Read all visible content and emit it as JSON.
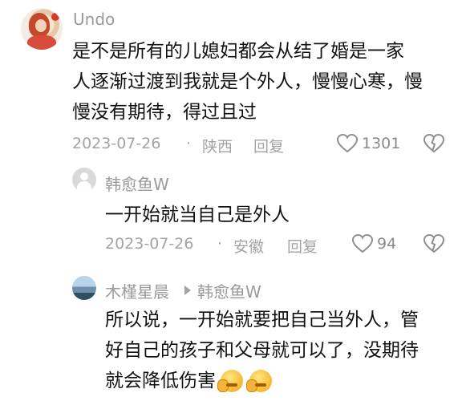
{
  "comments": [
    {
      "username": "Undo",
      "text_lines": [
        "是不是所有的儿媳妇都会从结了婚是一家",
        "人逐渐过渡到我就是个外人，慢慢心寒，慢",
        "慢没有期待，得过且过"
      ],
      "date": "2023-07-26",
      "separator": "·",
      "location": "陕西",
      "reply_label": "回复",
      "likes": "1301"
    }
  ],
  "replies": [
    {
      "username": "韩愈鱼W",
      "text_lines": [
        "一开始就当自己是外人"
      ],
      "date": "2023-07-26",
      "separator": "·",
      "location": "安徽",
      "reply_label": "回复",
      "likes": "94"
    },
    {
      "username": "木槿星晨",
      "reply_to": "韩愈鱼W",
      "text_lines": [
        "所以说，一开始就要把自己当外人，管",
        "好自己的孩子和父母就可以了，没期待",
        "就会降低伤害"
      ]
    }
  ],
  "icons": {
    "like": "heart-icon",
    "dislike": "broken-heart-icon",
    "reply_arrow": "play-arrow-icon",
    "emoji": "thinking-face-emoji"
  }
}
